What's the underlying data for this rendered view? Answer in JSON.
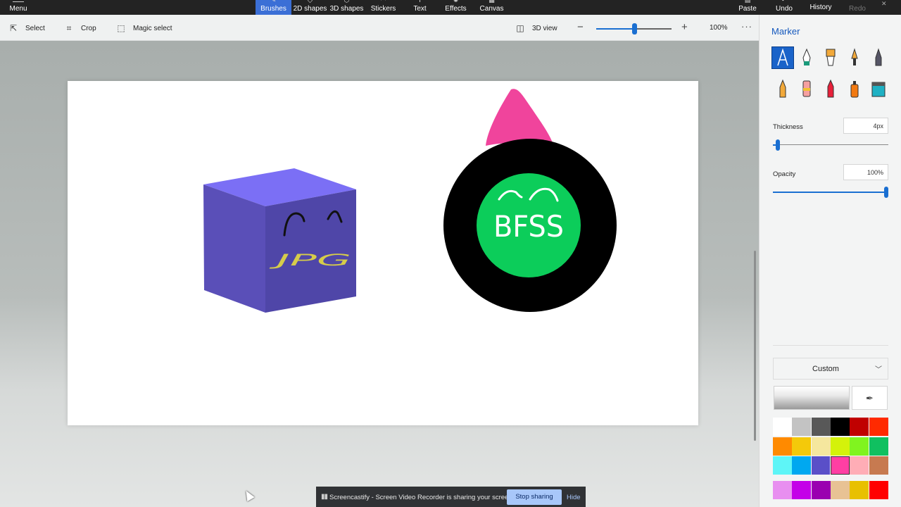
{
  "topbar": {
    "menu_label": "Menu",
    "tabs": [
      {
        "label": "Brushes",
        "active": true
      },
      {
        "label": "2D shapes"
      },
      {
        "label": "3D shapes"
      },
      {
        "label": "Stickers"
      },
      {
        "label": "Text"
      },
      {
        "label": "Effects"
      },
      {
        "label": "Canvas"
      }
    ],
    "paste_label": "Paste",
    "undo_label": "Undo",
    "history_label": "History",
    "redo_label": "Redo"
  },
  "toolbar": {
    "select_label": "Select",
    "crop_label": "Crop",
    "magic_select_label": "Magic select",
    "view3d_label": "3D view",
    "zoom_level": "100%",
    "zoom_fraction": 0.5
  },
  "canvas": {
    "cube_text": "JPG",
    "circle_text": "BFSS"
  },
  "share_bar": {
    "message": "Screencastify - Screen Video Recorder is sharing your screen.",
    "stop_label": "Stop sharing",
    "hide_label": "Hide"
  },
  "panel": {
    "title": "Marker",
    "brushes": [
      "marker-icon",
      "calligraphy-pen-icon",
      "oil-brush-icon",
      "watercolor-icon",
      "pixel-pen-icon",
      "pencil-icon",
      "eraser-icon",
      "crayon-icon",
      "spray-can-icon",
      "fill-icon"
    ],
    "selected_brush": 0,
    "thickness_label": "Thickness",
    "thickness_value": "4px",
    "thickness_fraction": 0.04,
    "opacity_label": "Opacity",
    "opacity_value": "100%",
    "opacity_fraction": 1.0,
    "color_mode": "Custom",
    "palette": [
      "#ffffff",
      "#c3c3c3",
      "#585858",
      "#000000",
      "#c00000",
      "#ff2a00",
      "#ff8a00",
      "#f4c90a",
      "#f5e79e",
      "#d4f20a",
      "#80f41f",
      "#10c060",
      "#5ef5f7",
      "#00a8f0",
      "#5a4fc8",
      "#ff3fa3",
      "#ffadb6",
      "#c77a50",
      "#e88ff0",
      "#c400e8",
      "#9a00b0",
      "#e8c294",
      "#e8c000",
      "#ff0000"
    ],
    "selected_swatch": 15
  }
}
